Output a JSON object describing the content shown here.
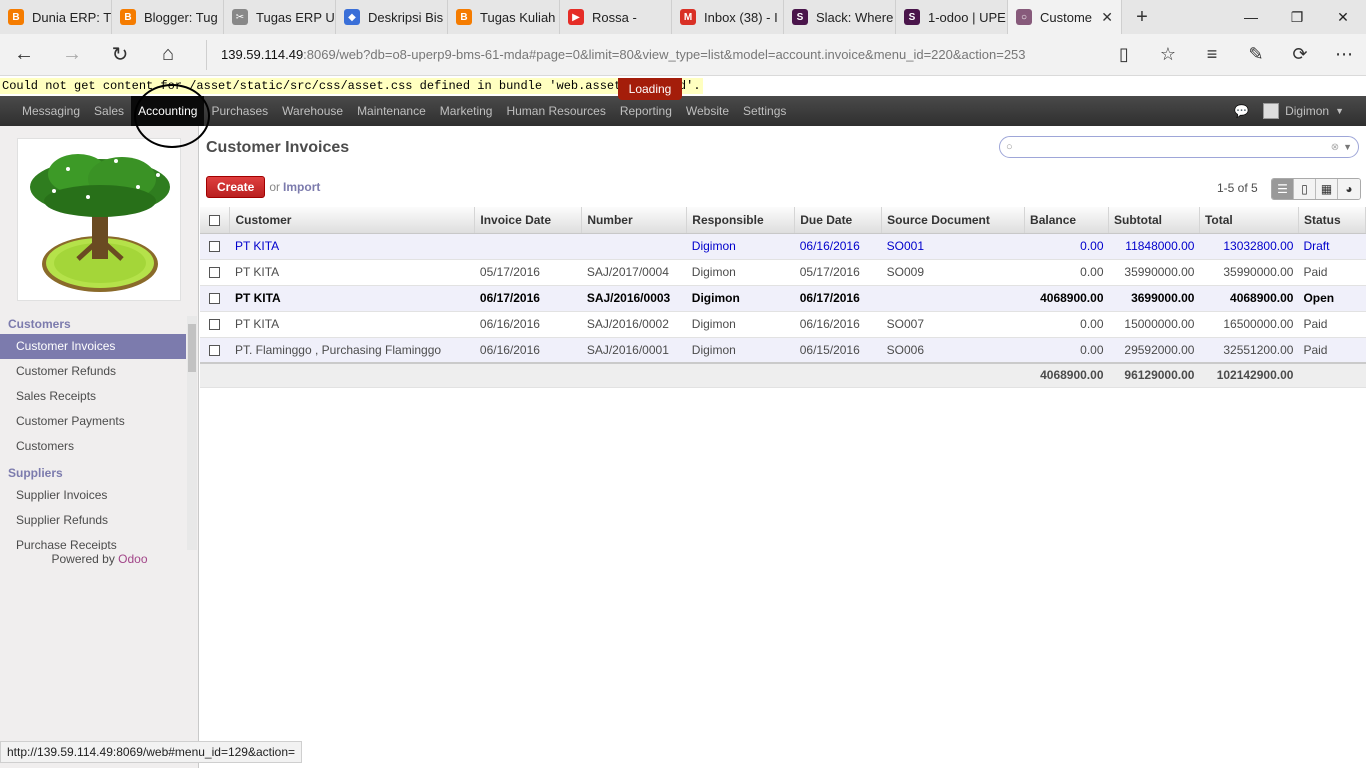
{
  "browser": {
    "tabs": [
      {
        "title": "Dunia ERP: T",
        "color": "#f57c00",
        "glyph": "B"
      },
      {
        "title": "Blogger: Tug",
        "color": "#f57c00",
        "glyph": "B"
      },
      {
        "title": "Tugas ERP U",
        "color": "#888888",
        "glyph": "✂"
      },
      {
        "title": "Deskripsi Bis",
        "color": "#3a6fd8",
        "glyph": "◆"
      },
      {
        "title": "Tugas Kuliah",
        "color": "#f57c00",
        "glyph": "B"
      },
      {
        "title": "Rossa - ",
        "color": "#e52d27",
        "glyph": "▶"
      },
      {
        "title": "Inbox (38) - I",
        "color": "#d93025",
        "glyph": "M"
      },
      {
        "title": "Slack: Where",
        "color": "#4a154b",
        "glyph": "S"
      },
      {
        "title": "1-odoo | UPE",
        "color": "#4a154b",
        "glyph": "S"
      },
      {
        "title": "Custome",
        "color": "#875a7b",
        "glyph": "○"
      }
    ],
    "url_host": "139.59.114.49",
    "url_rest": ":8069/web?db=o8-uperp9-bms-61-mda#page=0&limit=80&view_type=list&model=account.invoice&menu_id=220&action=253",
    "status_url": "http://139.59.114.49:8069/web#menu_id=129&action="
  },
  "error_text": "Could not get content for /asset/static/src/css/asset.css defined in bundle 'web.assets_backend'.",
  "loading_label": "Loading",
  "topmenu": {
    "items": [
      "Messaging",
      "Sales",
      "Accounting",
      "Purchases",
      "Warehouse",
      "Maintenance",
      "Marketing",
      "Human Resources",
      "Reporting",
      "Website",
      "Settings"
    ],
    "active": "Accounting",
    "user": "Digimon"
  },
  "sidebar": {
    "sections": [
      {
        "header": "Customers",
        "items": [
          "Customer Invoices",
          "Customer Refunds",
          "Sales Receipts",
          "Customer Payments",
          "Customers"
        ]
      },
      {
        "header": "Suppliers",
        "items": [
          "Supplier Invoices",
          "Supplier Refunds",
          "Purchase Receipts"
        ]
      }
    ],
    "active_item": "Customer Invoices",
    "powered_prefix": "Powered by ",
    "powered_brand": "Odoo"
  },
  "main": {
    "title": "Customer Invoices",
    "search_placeholder": "",
    "create_label": "Create",
    "or_label": "or",
    "import_label": "Import",
    "pager": "1-5 of 5"
  },
  "table": {
    "columns": [
      "Customer",
      "Invoice Date",
      "Number",
      "Responsible",
      "Due Date",
      "Source Document",
      "Balance",
      "Subtotal",
      "Total",
      "Status"
    ],
    "rows": [
      {
        "customer": "PT KITA",
        "invoice_date": "",
        "number": "",
        "responsible": "Digimon",
        "due_date": "06/16/2016",
        "source": "SO001",
        "balance": "0.00",
        "subtotal": "11848000.00",
        "total": "13032800.00",
        "status": "Draft"
      },
      {
        "customer": "PT KITA",
        "invoice_date": "05/17/2016",
        "number": "SAJ/2017/0004",
        "responsible": "Digimon",
        "due_date": "05/17/2016",
        "source": "SO009",
        "balance": "0.00",
        "subtotal": "35990000.00",
        "total": "35990000.00",
        "status": "Paid"
      },
      {
        "customer": "PT KITA",
        "invoice_date": "06/17/2016",
        "number": "SAJ/2016/0003",
        "responsible": "Digimon",
        "due_date": "06/17/2016",
        "source": "",
        "balance": "4068900.00",
        "subtotal": "3699000.00",
        "total": "4068900.00",
        "status": "Open"
      },
      {
        "customer": "PT KITA",
        "invoice_date": "06/16/2016",
        "number": "SAJ/2016/0002",
        "responsible": "Digimon",
        "due_date": "06/16/2016",
        "source": "SO007",
        "balance": "0.00",
        "subtotal": "15000000.00",
        "total": "16500000.00",
        "status": "Paid"
      },
      {
        "customer": "PT. Flaminggo , Purchasing Flaminggo",
        "invoice_date": "06/16/2016",
        "number": "SAJ/2016/0001",
        "responsible": "Digimon",
        "due_date": "06/15/2016",
        "source": "SO006",
        "balance": "0.00",
        "subtotal": "29592000.00",
        "total": "32551200.00",
        "status": "Paid"
      }
    ],
    "totals": {
      "balance": "4068900.00",
      "subtotal": "96129000.00",
      "total": "102142900.00"
    }
  }
}
